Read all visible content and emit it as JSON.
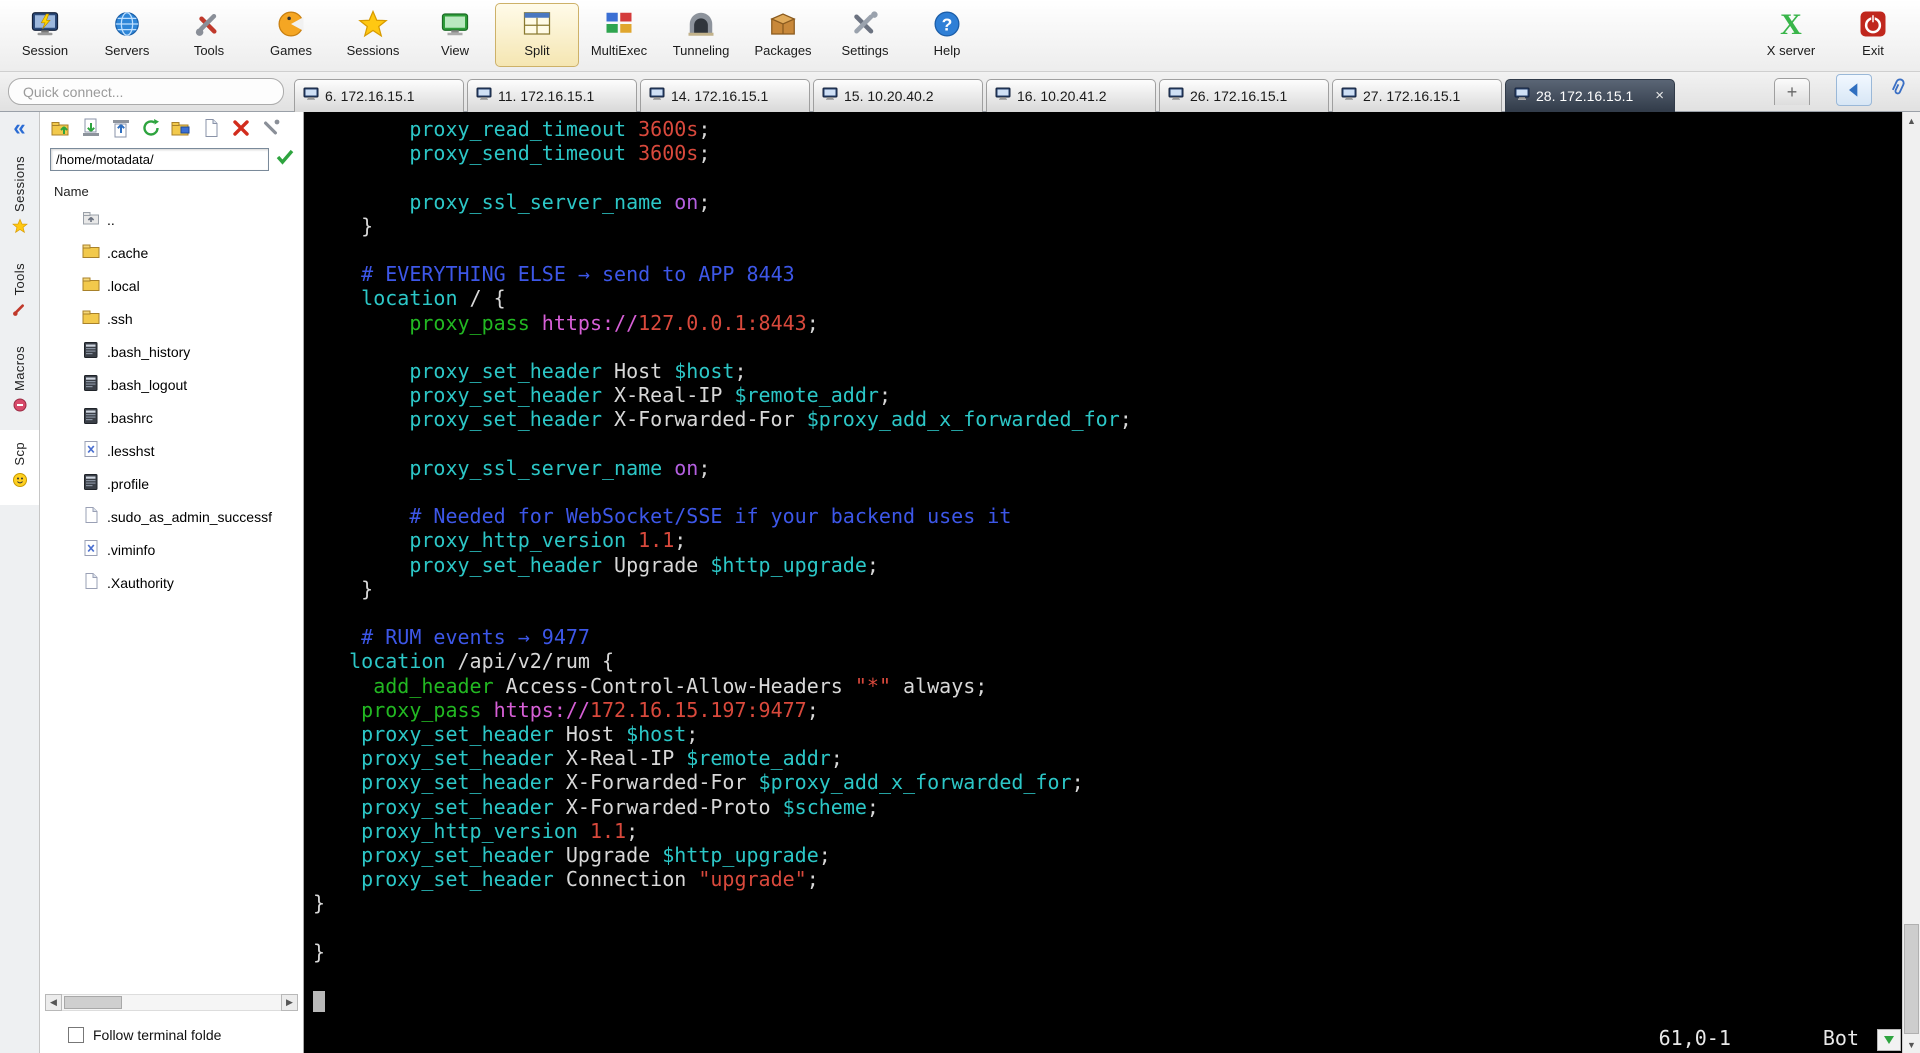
{
  "toolbar": {
    "left": [
      {
        "id": "session",
        "label": "Session"
      },
      {
        "id": "servers",
        "label": "Servers"
      },
      {
        "id": "tools",
        "label": "Tools"
      },
      {
        "id": "games",
        "label": "Games"
      },
      {
        "id": "sessions",
        "label": "Sessions"
      },
      {
        "id": "view",
        "label": "View"
      },
      {
        "id": "split",
        "label": "Split",
        "highlight": true
      },
      {
        "id": "multiexec",
        "label": "MultiExec"
      },
      {
        "id": "tunneling",
        "label": "Tunneling"
      },
      {
        "id": "packages",
        "label": "Packages"
      },
      {
        "id": "settings",
        "label": "Settings"
      },
      {
        "id": "help",
        "label": "Help"
      }
    ],
    "right": [
      {
        "id": "xserver",
        "label": "X server"
      },
      {
        "id": "exit",
        "label": "Exit"
      }
    ]
  },
  "quick_connect": {
    "placeholder": "Quick connect..."
  },
  "tabs": {
    "new_tab": "+",
    "items": [
      {
        "label": "6. 172.16.15.1",
        "active": false
      },
      {
        "label": "11. 172.16.15.1",
        "active": false
      },
      {
        "label": "14. 172.16.15.1",
        "active": false
      },
      {
        "label": "15. 10.20.40.2",
        "active": false
      },
      {
        "label": "16. 10.20.41.2",
        "active": false
      },
      {
        "label": "26. 172.16.15.1",
        "active": false
      },
      {
        "label": "27. 172.16.15.1",
        "active": false
      },
      {
        "label": "28. 172.16.15.1",
        "active": true,
        "close": "×"
      }
    ]
  },
  "sidebar": {
    "collapse": "«",
    "tabs": [
      {
        "id": "sessions",
        "label": "Sessions",
        "active": false
      },
      {
        "id": "tools",
        "label": "Tools",
        "active": false
      },
      {
        "id": "macros",
        "label": "Macros",
        "active": false
      },
      {
        "id": "scp",
        "label": "Scp",
        "active": true
      }
    ]
  },
  "sftp": {
    "toolbar": [
      "parent-dir",
      "download",
      "upload",
      "refresh",
      "open-folder",
      "new-file",
      "delete",
      "settings"
    ],
    "path": "/home/motadata/",
    "column_header": "Name",
    "files": [
      {
        "name": "..",
        "icon": "updir"
      },
      {
        "name": ".cache",
        "icon": "folder"
      },
      {
        "name": ".local",
        "icon": "folder"
      },
      {
        "name": ".ssh",
        "icon": "folder"
      },
      {
        "name": ".bash_history",
        "icon": "script"
      },
      {
        "name": ".bash_logout",
        "icon": "script"
      },
      {
        "name": ".bashrc",
        "icon": "script"
      },
      {
        "name": ".lesshst",
        "icon": "xfile"
      },
      {
        "name": ".profile",
        "icon": "script"
      },
      {
        "name": ".sudo_as_admin_successf",
        "icon": "plain"
      },
      {
        "name": ".viminfo",
        "icon": "xfile"
      },
      {
        "name": ".Xauthority",
        "icon": "plain"
      }
    ],
    "follow_label": "Follow terminal folde"
  },
  "terminal": {
    "palette": {
      "w": "#d8d8d8",
      "c": "#2cc7c7",
      "g": "#22b822",
      "r": "#d9493c",
      "b": "#3d57e8",
      "m": "#b45fe0",
      "p": "#d75fd7"
    },
    "status_position": "61,0-1",
    "status_mode": "Bot",
    "lines": [
      [
        {
          "t": "        "
        },
        {
          "t": "proxy_read_timeout",
          "c": "c"
        },
        {
          "t": " "
        },
        {
          "t": "3600s",
          "c": "r"
        },
        {
          "t": ";"
        }
      ],
      [
        {
          "t": "        "
        },
        {
          "t": "proxy_send_timeout",
          "c": "c"
        },
        {
          "t": " "
        },
        {
          "t": "3600s",
          "c": "r"
        },
        {
          "t": ";"
        }
      ],
      [],
      [
        {
          "t": "        "
        },
        {
          "t": "proxy_ssl_server_name",
          "c": "c"
        },
        {
          "t": " "
        },
        {
          "t": "on",
          "c": "m"
        },
        {
          "t": ";"
        }
      ],
      [
        {
          "t": "    }"
        }
      ],
      [],
      [
        {
          "t": "    "
        },
        {
          "t": "# EVERYTHING ELSE → send to APP 8443",
          "c": "b"
        }
      ],
      [
        {
          "t": "    "
        },
        {
          "t": "location",
          "c": "c"
        },
        {
          "t": " / {"
        }
      ],
      [
        {
          "t": "        "
        },
        {
          "t": "proxy_pass",
          "c": "g"
        },
        {
          "t": " "
        },
        {
          "t": "https://",
          "c": "p"
        },
        {
          "t": "127.0.0.1:8443",
          "c": "r"
        },
        {
          "t": ";"
        }
      ],
      [],
      [
        {
          "t": "        "
        },
        {
          "t": "proxy_set_header",
          "c": "c"
        },
        {
          "t": " Host "
        },
        {
          "t": "$host",
          "c": "c"
        },
        {
          "t": ";"
        }
      ],
      [
        {
          "t": "        "
        },
        {
          "t": "proxy_set_header",
          "c": "c"
        },
        {
          "t": " X-Real-IP "
        },
        {
          "t": "$remote_addr",
          "c": "c"
        },
        {
          "t": ";"
        }
      ],
      [
        {
          "t": "        "
        },
        {
          "t": "proxy_set_header",
          "c": "c"
        },
        {
          "t": " X-Forwarded-For "
        },
        {
          "t": "$proxy_add_x_forwarded_for",
          "c": "c"
        },
        {
          "t": ";"
        }
      ],
      [],
      [
        {
          "t": "        "
        },
        {
          "t": "proxy_ssl_server_name",
          "c": "c"
        },
        {
          "t": " "
        },
        {
          "t": "on",
          "c": "m"
        },
        {
          "t": ";"
        }
      ],
      [],
      [
        {
          "t": "        "
        },
        {
          "t": "# Needed for WebSocket/SSE if your backend uses it",
          "c": "b"
        }
      ],
      [
        {
          "t": "        "
        },
        {
          "t": "proxy_http_version",
          "c": "c"
        },
        {
          "t": " "
        },
        {
          "t": "1.1",
          "c": "r"
        },
        {
          "t": ";"
        }
      ],
      [
        {
          "t": "        "
        },
        {
          "t": "proxy_set_header",
          "c": "c"
        },
        {
          "t": " Upgrade "
        },
        {
          "t": "$http_upgrade",
          "c": "c"
        },
        {
          "t": ";"
        }
      ],
      [
        {
          "t": "    }"
        }
      ],
      [],
      [
        {
          "t": "    "
        },
        {
          "t": "# RUM events → 9477",
          "c": "b"
        }
      ],
      [
        {
          "t": "   "
        },
        {
          "t": "location",
          "c": "c"
        },
        {
          "t": " /api/v2/rum {"
        }
      ],
      [
        {
          "t": "     "
        },
        {
          "t": "add_header",
          "c": "g"
        },
        {
          "t": " Access-Control-Allow-Headers "
        },
        {
          "t": "\"*\"",
          "c": "r"
        },
        {
          "t": " always;"
        }
      ],
      [
        {
          "t": "    "
        },
        {
          "t": "proxy_pass",
          "c": "g"
        },
        {
          "t": " "
        },
        {
          "t": "https://",
          "c": "p"
        },
        {
          "t": "172.16.15.197:9477",
          "c": "r"
        },
        {
          "t": ";"
        }
      ],
      [
        {
          "t": "    "
        },
        {
          "t": "proxy_set_header",
          "c": "c"
        },
        {
          "t": " Host "
        },
        {
          "t": "$host",
          "c": "c"
        },
        {
          "t": ";"
        }
      ],
      [
        {
          "t": "    "
        },
        {
          "t": "proxy_set_header",
          "c": "c"
        },
        {
          "t": " X-Real-IP "
        },
        {
          "t": "$remote_addr",
          "c": "c"
        },
        {
          "t": ";"
        }
      ],
      [
        {
          "t": "    "
        },
        {
          "t": "proxy_set_header",
          "c": "c"
        },
        {
          "t": " X-Forwarded-For "
        },
        {
          "t": "$proxy_add_x_forwarded_for",
          "c": "c"
        },
        {
          "t": ";"
        }
      ],
      [
        {
          "t": "    "
        },
        {
          "t": "proxy_set_header",
          "c": "c"
        },
        {
          "t": " X-Forwarded-Proto "
        },
        {
          "t": "$scheme",
          "c": "c"
        },
        {
          "t": ";"
        }
      ],
      [
        {
          "t": "    "
        },
        {
          "t": "proxy_http_version",
          "c": "c"
        },
        {
          "t": " "
        },
        {
          "t": "1.1",
          "c": "r"
        },
        {
          "t": ";"
        }
      ],
      [
        {
          "t": "    "
        },
        {
          "t": "proxy_set_header",
          "c": "c"
        },
        {
          "t": " Upgrade "
        },
        {
          "t": "$http_upgrade",
          "c": "c"
        },
        {
          "t": ";"
        }
      ],
      [
        {
          "t": "    "
        },
        {
          "t": "proxy_set_header",
          "c": "c"
        },
        {
          "t": " Connection "
        },
        {
          "t": "\"upgrade\"",
          "c": "r"
        },
        {
          "t": ";"
        }
      ],
      [
        {
          "t": "}"
        }
      ],
      [],
      [
        {
          "t": "}"
        }
      ],
      [],
      [
        {
          "cursor": true
        }
      ]
    ]
  }
}
